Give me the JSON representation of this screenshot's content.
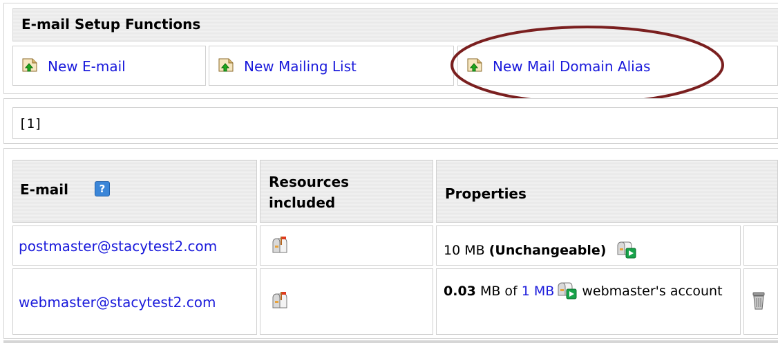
{
  "setup": {
    "title": "E-mail Setup Functions",
    "actions": [
      {
        "label": "New E-mail",
        "icon": "add-page-icon"
      },
      {
        "label": "New Mailing List",
        "icon": "add-page-icon"
      },
      {
        "label": "New Mail Domain Alias",
        "icon": "add-page-icon"
      }
    ]
  },
  "pager": {
    "text": "[1]"
  },
  "table": {
    "headers": {
      "email": "E-mail",
      "resources": "Resources included",
      "properties": "Properties"
    },
    "rows": [
      {
        "email": "postmaster@stacytest2.com",
        "quota": "10 MB",
        "quota_note": "(Unchangeable)"
      },
      {
        "email": "webmaster@stacytest2.com",
        "used": "0.03",
        "of_text": "MB of",
        "limit": "1 MB",
        "owner": "webmaster's account"
      }
    ]
  },
  "colors": {
    "link": "#1a1adb",
    "highlight_ring": "#7a1f1f",
    "help": "#3b86d8"
  }
}
